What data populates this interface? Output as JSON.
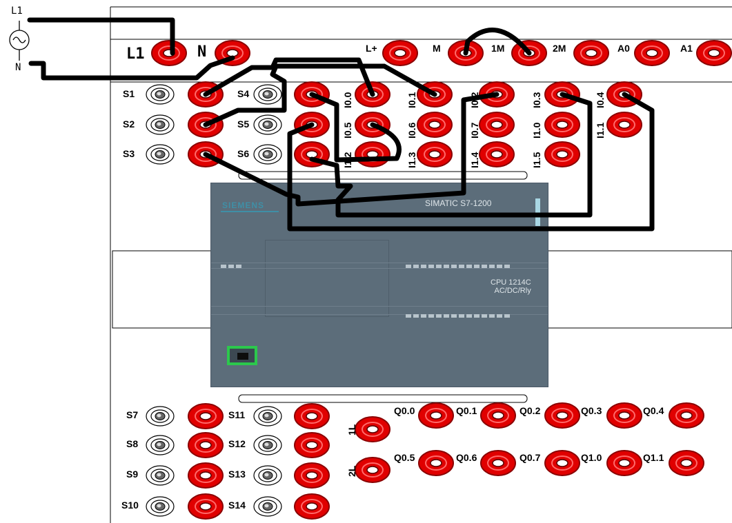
{
  "supply": {
    "l1_label": "L1",
    "n_label": "N"
  },
  "panel": {
    "top_terminals": {
      "l1": "L1",
      "n": "N",
      "lplus": "L+",
      "m": "M",
      "m1": "1M",
      "m2": "2M",
      "a0": "A0",
      "a1": "A1"
    },
    "switches_upper": [
      "S1",
      "S2",
      "S3",
      "S4",
      "S5",
      "S6"
    ],
    "switches_lower": [
      "S7",
      "S8",
      "S9",
      "S10",
      "S11",
      "S12",
      "S13",
      "S14"
    ],
    "inputs": [
      "I0.0",
      "I0.1",
      "I0.2",
      "I0.3",
      "I0.4",
      "I0.5",
      "I0.6",
      "I0.7",
      "I1.0",
      "I1.1",
      "I1.2",
      "I1.3",
      "I1.4",
      "I1.5"
    ],
    "outputs_row1": [
      "Q0.0",
      "Q0.1",
      "Q0.2",
      "Q0.3",
      "Q0.4"
    ],
    "outputs_row2": [
      "Q0.5",
      "Q0.6",
      "Q0.7",
      "Q1.0",
      "Q1.1"
    ],
    "commons": [
      "1L",
      "2L"
    ]
  },
  "plc": {
    "brand": "SIEMENS",
    "model": "SIMATIC S7-1200",
    "cpu_line1": "CPU 1214C",
    "cpu_line2": "AC/DC/Rly"
  },
  "colors": {
    "terminal_red": "#e00000",
    "plc_body": "#5c6d7a",
    "wire": "#000000",
    "ethernet_port": "#2cc84c"
  }
}
